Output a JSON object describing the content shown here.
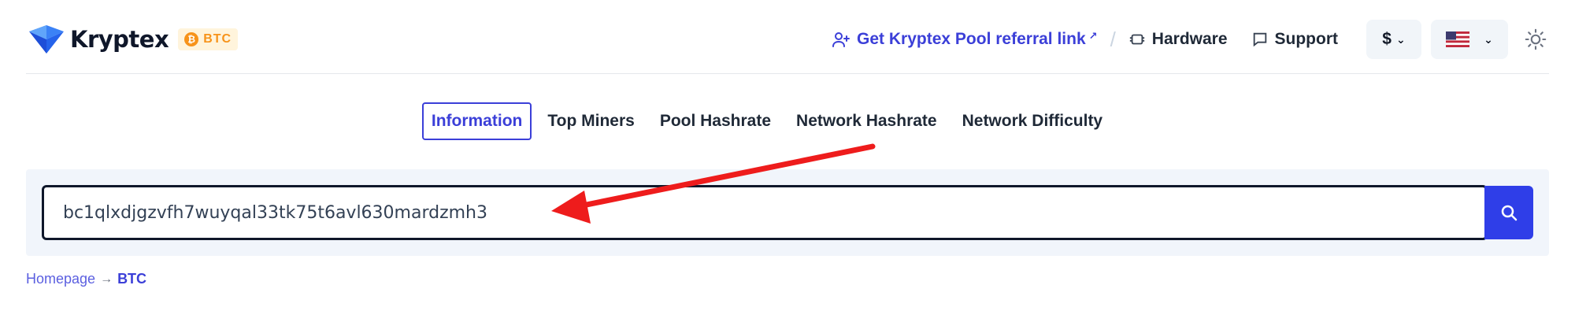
{
  "header": {
    "brand": "Kryptex",
    "coin_badge": "BTC",
    "coin_symbol": "₿",
    "referral_link": "Get Kryptex Pool referral link",
    "separator": "/",
    "hardware": "Hardware",
    "support": "Support",
    "currency": "$",
    "language_flag": "us-flag-icon",
    "theme_icon": "sun-icon"
  },
  "tabs": [
    {
      "label": "Information",
      "active": true
    },
    {
      "label": "Top Miners",
      "active": false
    },
    {
      "label": "Pool Hashrate",
      "active": false
    },
    {
      "label": "Network Hashrate",
      "active": false
    },
    {
      "label": "Network Difficulty",
      "active": false
    }
  ],
  "search": {
    "value": "bc1qlxdjgzvfh7wuyqal33tk75t6avl630mardzmh3",
    "button_icon": "search-icon"
  },
  "breadcrumb": {
    "home": "Homepage",
    "separator": "→",
    "current": "BTC"
  },
  "colors": {
    "accent": "#3b3fd8",
    "search_button": "#2f3ee8",
    "btc_orange": "#f7931a",
    "annotation_arrow": "#ee1c1c"
  }
}
